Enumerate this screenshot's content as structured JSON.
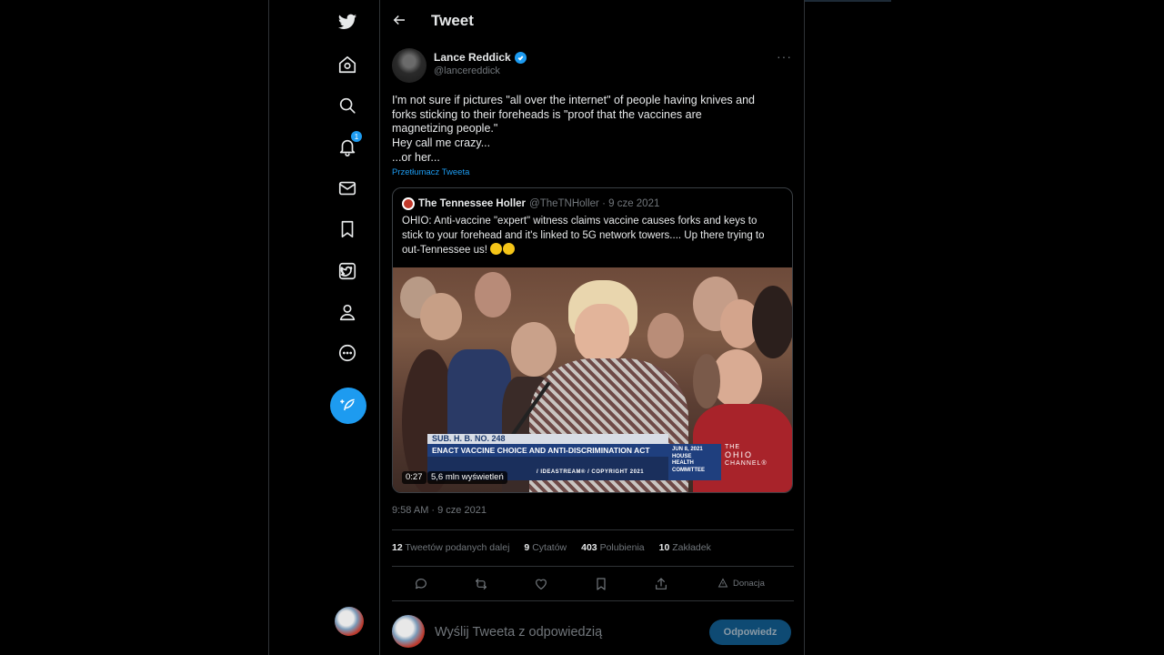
{
  "header": {
    "title": "Tweet"
  },
  "sidebar": {
    "notification_count": "1",
    "items": [
      "twitter-logo",
      "home",
      "explore",
      "notifications",
      "messages",
      "bookmarks",
      "twitter-blue",
      "profile",
      "more"
    ]
  },
  "tweet": {
    "author_name": "Lance Reddick",
    "author_handle": "@lancereddick",
    "text_lines": [
      "I'm not sure if pictures \"all over the internet\" of people having knives and",
      "forks sticking to their foreheads is \"proof that the vaccines are",
      "magnetizing people.\"",
      "Hey call me crazy...",
      "...or her..."
    ],
    "translate_label": "Przetłumacz Tweeta",
    "timestamp": "9:58 AM · 9 cze 2021"
  },
  "quote": {
    "name": "The Tennessee Holler",
    "handle_date": "@TheTNHoller · 9 cze 2021",
    "text_lines": [
      "OHIO: Anti-vaccine \"expert\" witness claims vaccine causes forks and keys to",
      "stick to your forehead and it's linked to 5G network towers.... Up there trying to",
      "out-Tennessee us!"
    ],
    "video": {
      "banner_bill": "SUB. H. B. NO. 248",
      "banner_title": "ENACT VACCINE CHOICE AND ANTI-DISCRIMINATION ACT",
      "banner_credit": "/ IDEASTREAM® / COPYRIGHT 2021",
      "date_box_date": "JUN 8, 2021",
      "date_box_lines": [
        "HOUSE",
        "HEALTH",
        "COMMITTEE"
      ],
      "channel_the": "THE",
      "channel_name": "OHIO",
      "channel_suffix": "CHANNEL®",
      "duration": "0:27",
      "views": "5,6 mln wyświetleń"
    }
  },
  "stats": [
    {
      "count": "12",
      "label": "Tweetów podanych dalej"
    },
    {
      "count": "9",
      "label": "Cytatów"
    },
    {
      "count": "403",
      "label": "Polubienia"
    },
    {
      "count": "10",
      "label": "Zakładek"
    }
  ],
  "actions": {
    "donate_label": "Donacja"
  },
  "reply": {
    "placeholder": "Wyślij Tweeta z odpowiedzią",
    "button_label": "Odpowiedz"
  },
  "colors": {
    "accent": "#1d9bf0",
    "background": "#000000",
    "muted": "#71767b"
  }
}
